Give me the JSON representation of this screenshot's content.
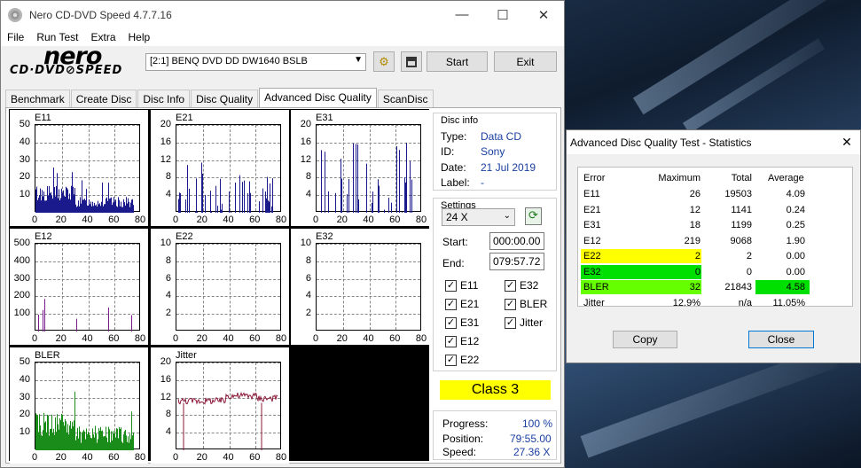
{
  "window": {
    "title": "Nero CD-DVD Speed 4.7.7.16",
    "min": "—",
    "max": "☐",
    "close": "✕"
  },
  "menu": [
    "File",
    "Run Test",
    "Extra",
    "Help"
  ],
  "logo": {
    "top": "nero",
    "bottom": "CD·DVD⊘SPEED"
  },
  "drive": "[2:1]   BENQ DVD DD DW1640 BSLB",
  "buttons": {
    "start": "Start",
    "exit": "Exit"
  },
  "tabs": [
    "Benchmark",
    "Create Disc",
    "Disc Info",
    "Disc Quality",
    "Advanced Disc Quality",
    "ScanDisc"
  ],
  "active_tab": "Advanced Disc Quality",
  "disc_info": {
    "title": "Disc info",
    "type_label": "Type:",
    "type": "Data CD",
    "id_label": "ID:",
    "id": "Sony",
    "date_label": "Date:",
    "date": "21 Jul 2019",
    "label_label": "Label:",
    "label": "-"
  },
  "settings": {
    "title": "Settings",
    "speed": "24 X",
    "start_label": "Start:",
    "start": "000:00.00",
    "end_label": "End:",
    "end": "079:57.72"
  },
  "checks": {
    "e11": "E11",
    "e32": "E32",
    "e21": "E21",
    "bler": "BLER",
    "e31": "E31",
    "jitter": "Jitter",
    "e12": "E12",
    "e22": "E22"
  },
  "class": "Class 3",
  "progress": {
    "progress_label": "Progress:",
    "progress": "100 %",
    "position_label": "Position:",
    "position": "79:55.00",
    "speed_label": "Speed:",
    "speed": "27.36 X"
  },
  "stats": {
    "title": "Advanced Disc Quality Test - Statistics",
    "headers": [
      "Error",
      "Maximum",
      "Total",
      "Average"
    ],
    "rows": [
      {
        "name": "E11",
        "max": "26",
        "total": "19503",
        "avg": "4.09"
      },
      {
        "name": "E21",
        "max": "12",
        "total": "1141",
        "avg": "0.24"
      },
      {
        "name": "E31",
        "max": "18",
        "total": "1199",
        "avg": "0.25"
      },
      {
        "name": "E12",
        "max": "219",
        "total": "9068",
        "avg": "1.90"
      },
      {
        "name": "E22",
        "max": "2",
        "total": "2",
        "avg": "0.00"
      },
      {
        "name": "E32",
        "max": "0",
        "total": "0",
        "avg": "0.00"
      },
      {
        "name": "BLER",
        "max": "32",
        "total": "21843",
        "avg": "4.58"
      },
      {
        "name": "Jitter",
        "max": "12.9%",
        "total": "n/a",
        "avg": "11.05%"
      }
    ],
    "copy": "Copy",
    "close": "Close"
  },
  "chart_data": [
    {
      "type": "bar",
      "title": "E11",
      "yticks": [
        "50",
        "40",
        "30",
        "20",
        "10"
      ],
      "xticks": [
        "0",
        "20",
        "40",
        "60",
        "80"
      ],
      "ylim": [
        0,
        50
      ],
      "color": "#1a1a8c"
    },
    {
      "type": "bar",
      "title": "E21",
      "yticks": [
        "20",
        "16",
        "12",
        "8",
        "4"
      ],
      "xticks": [
        "0",
        "20",
        "40",
        "60",
        "80"
      ],
      "ylim": [
        0,
        20
      ],
      "color": "#1a1a8c"
    },
    {
      "type": "bar",
      "title": "E31",
      "yticks": [
        "20",
        "16",
        "12",
        "8",
        "4"
      ],
      "xticks": [
        "0",
        "20",
        "40",
        "60",
        "80"
      ],
      "ylim": [
        0,
        20
      ],
      "color": "#1a1a8c"
    },
    {
      "type": "bar",
      "title": "E12",
      "yticks": [
        "500",
        "400",
        "300",
        "200",
        "100"
      ],
      "xticks": [
        "0",
        "20",
        "40",
        "60",
        "80"
      ],
      "ylim": [
        0,
        500
      ],
      "color": "#7a1a8c"
    },
    {
      "type": "bar",
      "title": "E22",
      "yticks": [
        "10",
        "8",
        "6",
        "4",
        "2"
      ],
      "xticks": [
        "0",
        "20",
        "40",
        "60",
        "80"
      ],
      "ylim": [
        0,
        10
      ],
      "color": "#7a1a8c"
    },
    {
      "type": "bar",
      "title": "E32",
      "yticks": [
        "10",
        "8",
        "6",
        "4",
        "2"
      ],
      "xticks": [
        "0",
        "20",
        "40",
        "60",
        "80"
      ],
      "ylim": [
        0,
        10
      ],
      "color": "#7a1a8c"
    },
    {
      "type": "bar",
      "title": "BLER",
      "yticks": [
        "50",
        "40",
        "30",
        "20",
        "10"
      ],
      "xticks": [
        "0",
        "20",
        "40",
        "60",
        "80"
      ],
      "ylim": [
        0,
        50
      ],
      "color": "#1a8c1a"
    },
    {
      "type": "line",
      "title": "Jitter",
      "yticks": [
        "20",
        "16",
        "12",
        "8",
        "4"
      ],
      "xticks": [
        "0",
        "20",
        "40",
        "60",
        "80"
      ],
      "ylim": [
        0,
        20
      ],
      "color": "#8c1a3a"
    }
  ]
}
